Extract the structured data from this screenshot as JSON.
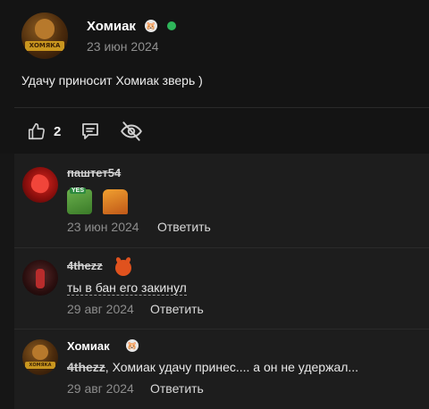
{
  "post": {
    "author": "Хомиак",
    "author_badge_icon": "hamster-emoji-icon",
    "online_status_color": "#2eb55a",
    "date": "23 июн 2024",
    "text": "Удачу приносит Хомиак зверь )",
    "avatar_banner_text": "ХОМЯКА",
    "actions": {
      "like_icon": "thumbs-up-icon",
      "like_count": "2",
      "comment_icon": "comment-icon",
      "hide_icon": "eye-off-icon"
    }
  },
  "comments": [
    {
      "author": "паштет54",
      "author_struck": true,
      "stickers": [
        "pepe-yes-sticker",
        "fry-sticker"
      ],
      "date": "23 июн 2024",
      "reply_label": "Ответить"
    },
    {
      "author": "4thezz",
      "author_struck": true,
      "author_badge_icon": "devil-emoji-icon",
      "text": "ты в бан его закинул",
      "date": "29 авг 2024",
      "reply_label": "Ответить"
    },
    {
      "author": "Хомиак",
      "author_badge_icon": "hamster-emoji-icon",
      "mention": "4thezz",
      "text": ", Хомиак удачу принес.... а он не удержал...",
      "date": "29 авг 2024",
      "reply_label": "Ответить",
      "avatar_banner_text": "ХОМЯКА"
    }
  ],
  "colors": {
    "background": "#161616",
    "comments_background": "#1d1d1d",
    "muted_text": "#8f8f8f"
  }
}
